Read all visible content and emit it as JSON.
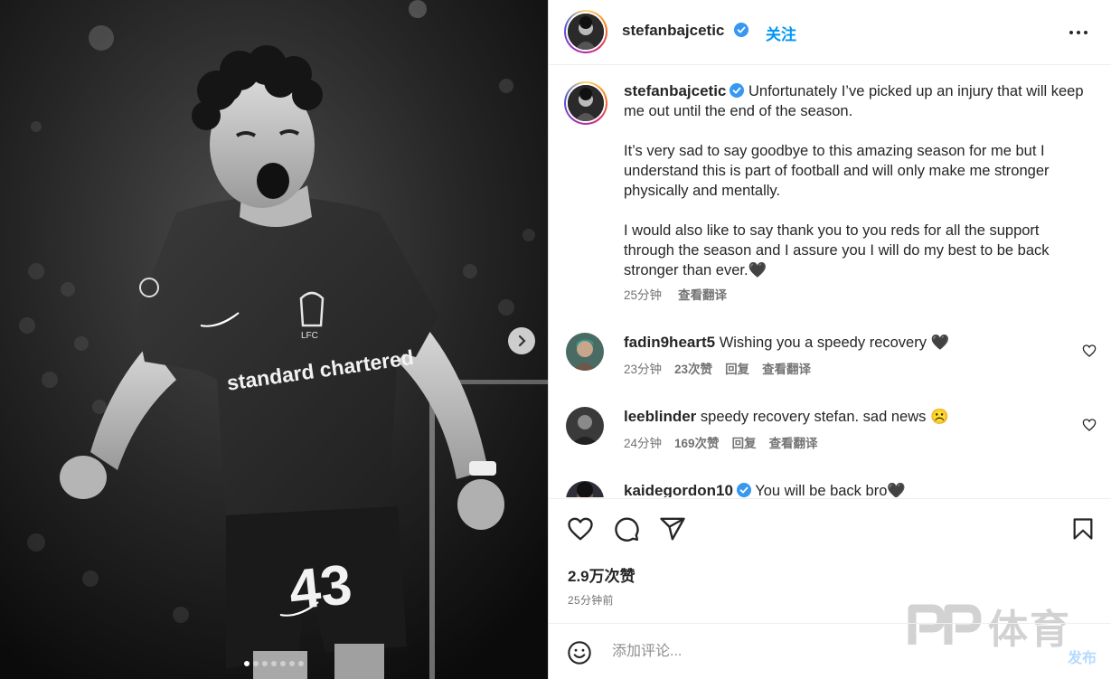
{
  "post": {
    "username": "stefanbajcetic",
    "follow_label": "关注",
    "caption_paragraphs": [
      "Unfortunately I’ve picked up an injury that will keep me out until the end of the season.",
      "It’s very sad to say goodbye to this amazing season for me but I understand this is part of football and will only make me stronger physically and mentally.",
      "I would also like to say thank you to you reds for all the support through the season and I assure you I will do my best to be back stronger than ever.🖤"
    ],
    "caption_time": "25分钟",
    "caption_translate": "查看翻译",
    "likes": "2.9万次赞",
    "time_ago": "25分钟前"
  },
  "media": {
    "jersey_brand": "standard chartered",
    "jersey_number": "43",
    "club_badge": "LFC",
    "slide_count": 7,
    "active_slide": 1
  },
  "comments": [
    {
      "username": "fadin9heart5",
      "text": "Wishing you a speedy recovery 🖤",
      "time": "23分钟",
      "likes": "23次赞",
      "reply": "回复",
      "translate": "查看翻译"
    },
    {
      "username": "leeblinder",
      "text": "speedy recovery stefan. sad news ☹️",
      "time": "24分钟",
      "likes": "169次赞",
      "reply": "回复",
      "translate": "查看翻译"
    },
    {
      "username": "kaidegordon10",
      "text": "You will be back bro🖤"
    }
  ],
  "composer": {
    "placeholder": "添加评论...",
    "post_label": "发布"
  },
  "watermark": {
    "text": "体育"
  },
  "icons": {
    "more": "more-horizontal-icon",
    "like": "heart-icon",
    "comment": "comment-bubble-icon",
    "share": "paper-plane-icon",
    "save": "bookmark-icon",
    "emoji": "emoji-smile-icon",
    "next": "chevron-right-icon",
    "verified": "verified-badge-icon"
  },
  "colors": {
    "link_blue": "#0095f6",
    "verified_blue": "#3897f0",
    "post_disabled": "#b3dbff",
    "muted_text": "#737373"
  }
}
